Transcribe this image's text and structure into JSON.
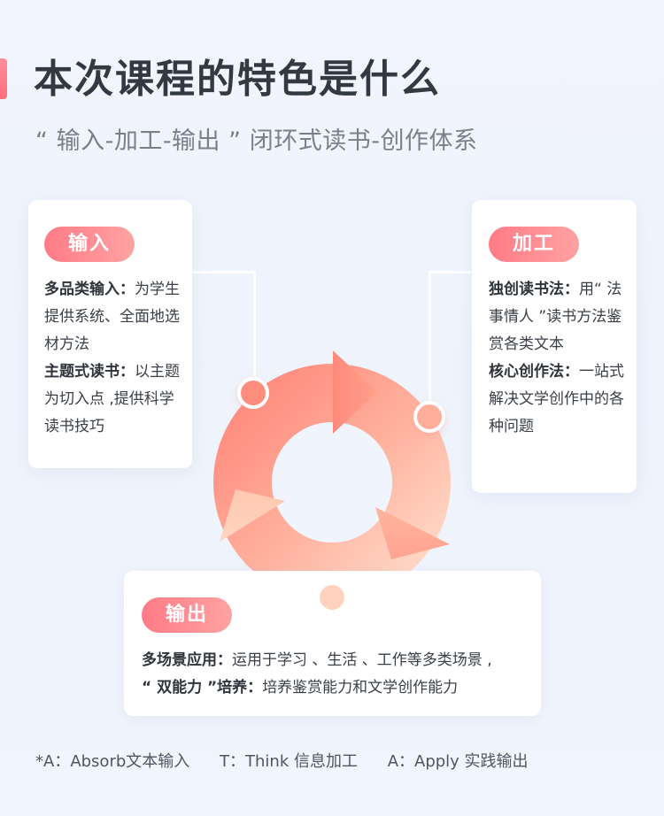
{
  "header": {
    "title": "本次课程的特色是什么",
    "subtitle": "“ 输入-加工-输出 ” 闭环式读书-创作体系"
  },
  "cards": {
    "input": {
      "tag": "输入",
      "items": [
        {
          "label": "多品类输入：",
          "text": "为学生提供系统、全面地选材方法"
        },
        {
          "label": "主题式读书：",
          "text": "以主题为切入点 ,提供科学读书技巧"
        }
      ]
    },
    "process": {
      "tag": "加工",
      "items": [
        {
          "label": "独创读书法：",
          "text": "用“ 法事情人 ”读书方法鉴赏各类文本"
        },
        {
          "label": "核心创作法：",
          "text": "一站式解决文学创作中的各种问题"
        }
      ]
    },
    "output": {
      "tag": "输出",
      "items": [
        {
          "label": "多场景应用：",
          "text": "运用于学习 、生活 、工作等多类场景 ,"
        },
        {
          "label": "“ 双能力 ”培养：",
          "text": "培养鉴赏能力和文学创作能力"
        }
      ]
    }
  },
  "footer": {
    "a_absorb": "*A：Absorb文本输入",
    "t_think": "T：Think 信息加工",
    "a_apply": "A：Apply 实践输出"
  },
  "colors": {
    "accent": "#ff6b7b",
    "pill_start": "#ff7b86",
    "pill_end": "#ffa2a2",
    "ring_dark": "#ff8a7c",
    "ring_light": "#ffd6c2"
  }
}
